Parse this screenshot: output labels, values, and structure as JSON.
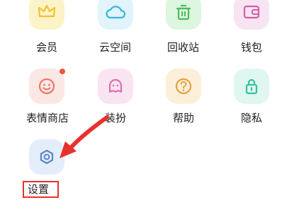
{
  "grid": {
    "items": [
      {
        "label": "会员",
        "icon": "crown-icon",
        "tile_color": "#fcf3c8",
        "icon_color": "#f2c230"
      },
      {
        "label": "云空间",
        "icon": "cloud-icon",
        "tile_color": "#e1f3fb",
        "icon_color": "#38b6e0"
      },
      {
        "label": "回收站",
        "icon": "trash-icon",
        "tile_color": "#ddf6df",
        "icon_color": "#4cbc5a"
      },
      {
        "label": "钱包",
        "icon": "wallet-icon",
        "tile_color": "#f7e4f2",
        "icon_color": "#d45ca6"
      },
      {
        "label": "表情商店",
        "icon": "smiley-icon",
        "tile_color": "#fbe7e4",
        "icon_color": "#e8786a",
        "badge": true
      },
      {
        "label": "装扮",
        "icon": "ghost-icon",
        "tile_color": "#f9e4f1",
        "icon_color": "#dd6fb0"
      },
      {
        "label": "帮助",
        "icon": "help-icon",
        "tile_color": "#fcefd9",
        "icon_color": "#e4a23e"
      },
      {
        "label": "隐私",
        "icon": "lock-icon",
        "tile_color": "#dff6f1",
        "icon_color": "#36bfa2"
      },
      {
        "label": "设置",
        "icon": "gear-icon",
        "tile_color": "#e3eefa",
        "icon_color": "#5b86c6"
      }
    ]
  },
  "annotation": {
    "arrow_color": "#e8322b"
  }
}
